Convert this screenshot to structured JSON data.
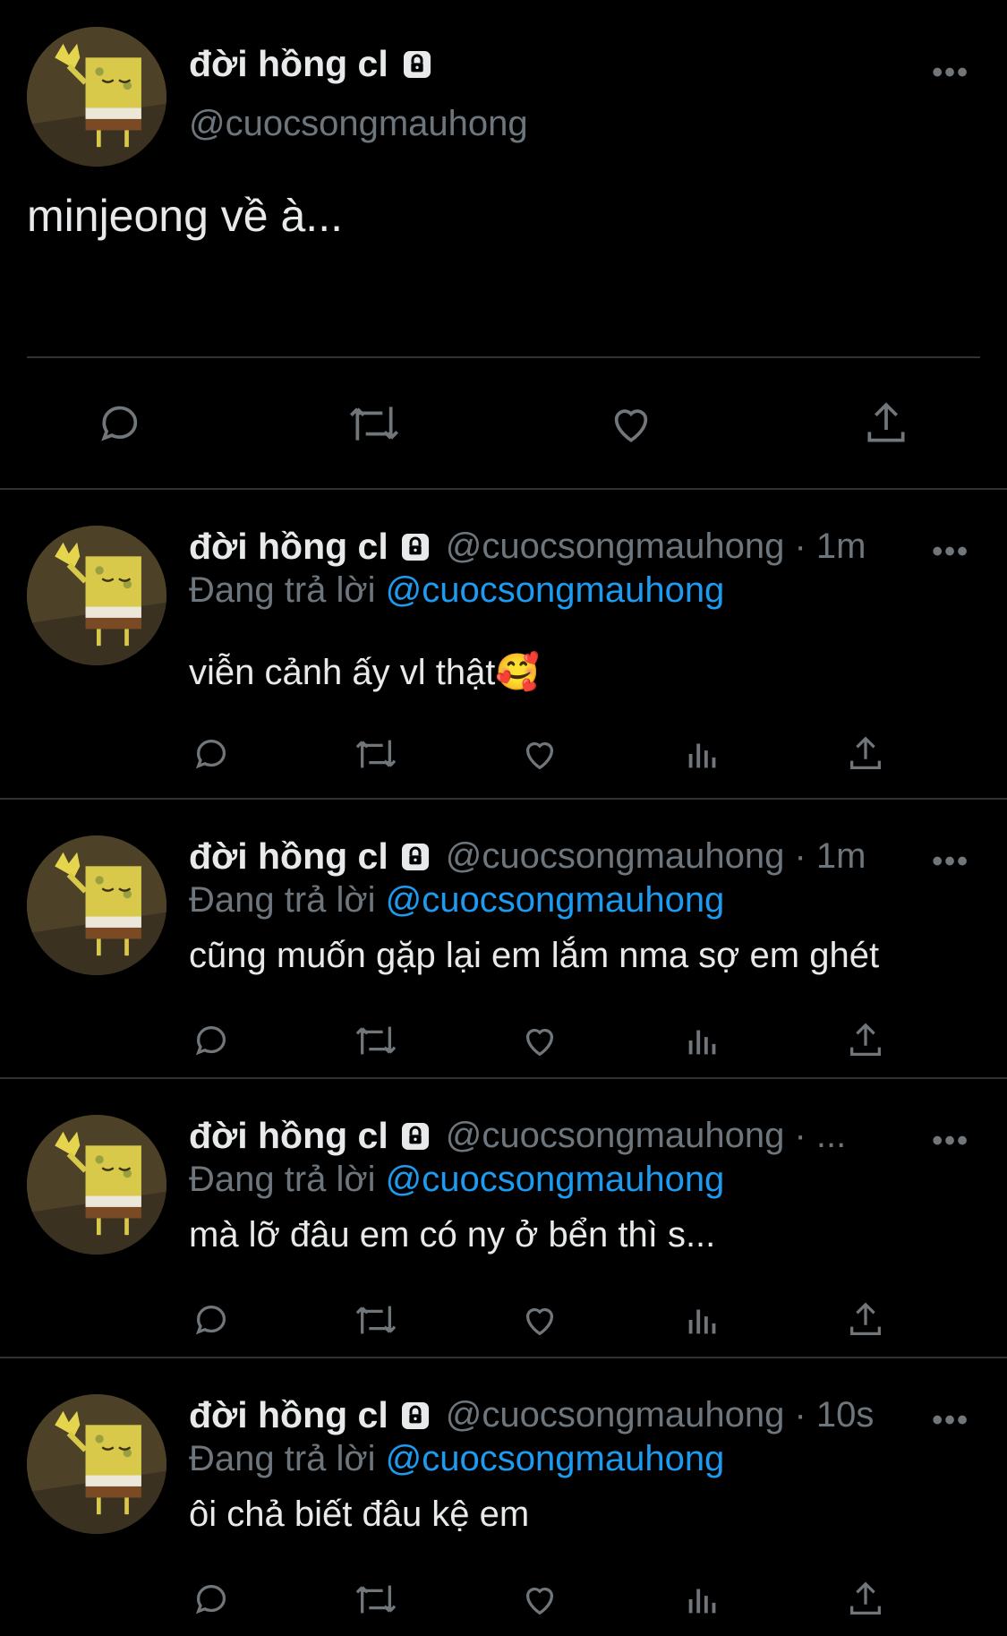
{
  "colors": {
    "background": "#000000",
    "text": "#e7e9ea",
    "muted": "#6e767d",
    "link": "#1d9bf0",
    "divider": "#2f3336"
  },
  "main_tweet": {
    "display_name": "đời hồng cl",
    "handle": "@cuocsongmauhong",
    "text": "minjeong về à...",
    "more_icon": "more-horizontal-icon",
    "actions": [
      "reply-icon",
      "retweet-icon",
      "like-icon",
      "share-icon"
    ]
  },
  "replies": [
    {
      "display_name": "đời hồng cl",
      "meta": "@cuocsongmauhong · 1m",
      "replying_label": "Đang trả lời",
      "replying_handle": "@cuocsongmauhong",
      "text": "viễn cảnh ấy vl thật🥰"
    },
    {
      "display_name": "đời hồng cl",
      "meta": "@cuocsongmauhong · 1m",
      "replying_label": "Đang trả lời",
      "replying_handle": "@cuocsongmauhong",
      "text": "cũng muốn gặp lại em lắm nma sợ em ghét"
    },
    {
      "display_name": "đời hồng cl",
      "meta": "@cuocsongmauhong · ...",
      "replying_label": "Đang trả lời",
      "replying_handle": "@cuocsongmauhong",
      "text": "mà lỡ đâu em có ny ở bển thì s..."
    },
    {
      "display_name": "đời hồng cl",
      "meta": "@cuocsongmauhong · 10s",
      "replying_label": "Đang trả lời",
      "replying_handle": "@cuocsongmauhong",
      "text": "ôi chả biết đâu kệ em"
    }
  ]
}
